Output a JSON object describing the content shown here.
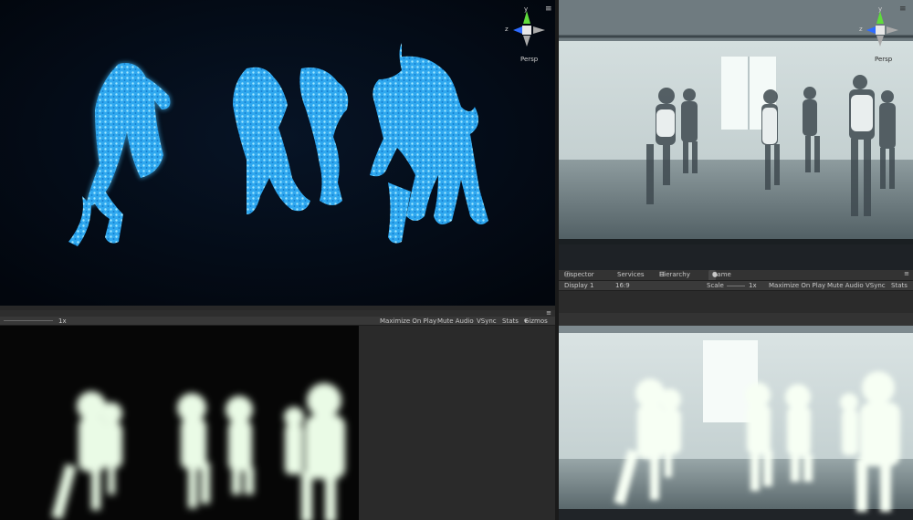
{
  "scene_view_top": {
    "gizmo": {
      "y_label": "y",
      "z_label": "z"
    },
    "persp_label": "Persp",
    "menu_glyph": "≡"
  },
  "scene_view_camera": {
    "gizmo": {
      "y_label": "y",
      "z_label": "z"
    },
    "persp_label": "Persp",
    "menu_glyph": "≡"
  },
  "bottom_left_toolbar": {
    "scale_value": "1x",
    "maximize_on_play": "Maximize On Play",
    "mute_audio": "Mute Audio",
    "vsync": "VSync",
    "stats": "Stats",
    "gizmos": "Gizmos",
    "gizmos_arrow": "▾"
  },
  "tabs": [
    {
      "icon": "ⓘ",
      "label": "Inspector",
      "active": false
    },
    {
      "icon": "",
      "label": "Services",
      "active": false
    },
    {
      "icon": "☰",
      "label": "Hierarchy",
      "active": false
    },
    {
      "icon": "●",
      "label": "Game",
      "active": true
    }
  ],
  "game_toolbar": {
    "display": "Display 1",
    "aspect": "16:9",
    "scale_label": "Scale",
    "scale_value": "1x",
    "maximize_on_play": "Maximize On Play",
    "mute_audio": "Mute Audio",
    "vsync": "VSync",
    "stats": "Stats"
  },
  "colors": {
    "editor_bg": "#282828",
    "toolbar_bg": "#3a3a3a",
    "particle_blue": "#35b8ff",
    "glow_white": "#f4fff0",
    "gizmo_y": "#5fdc3c",
    "gizmo_z": "#2e6bff"
  }
}
